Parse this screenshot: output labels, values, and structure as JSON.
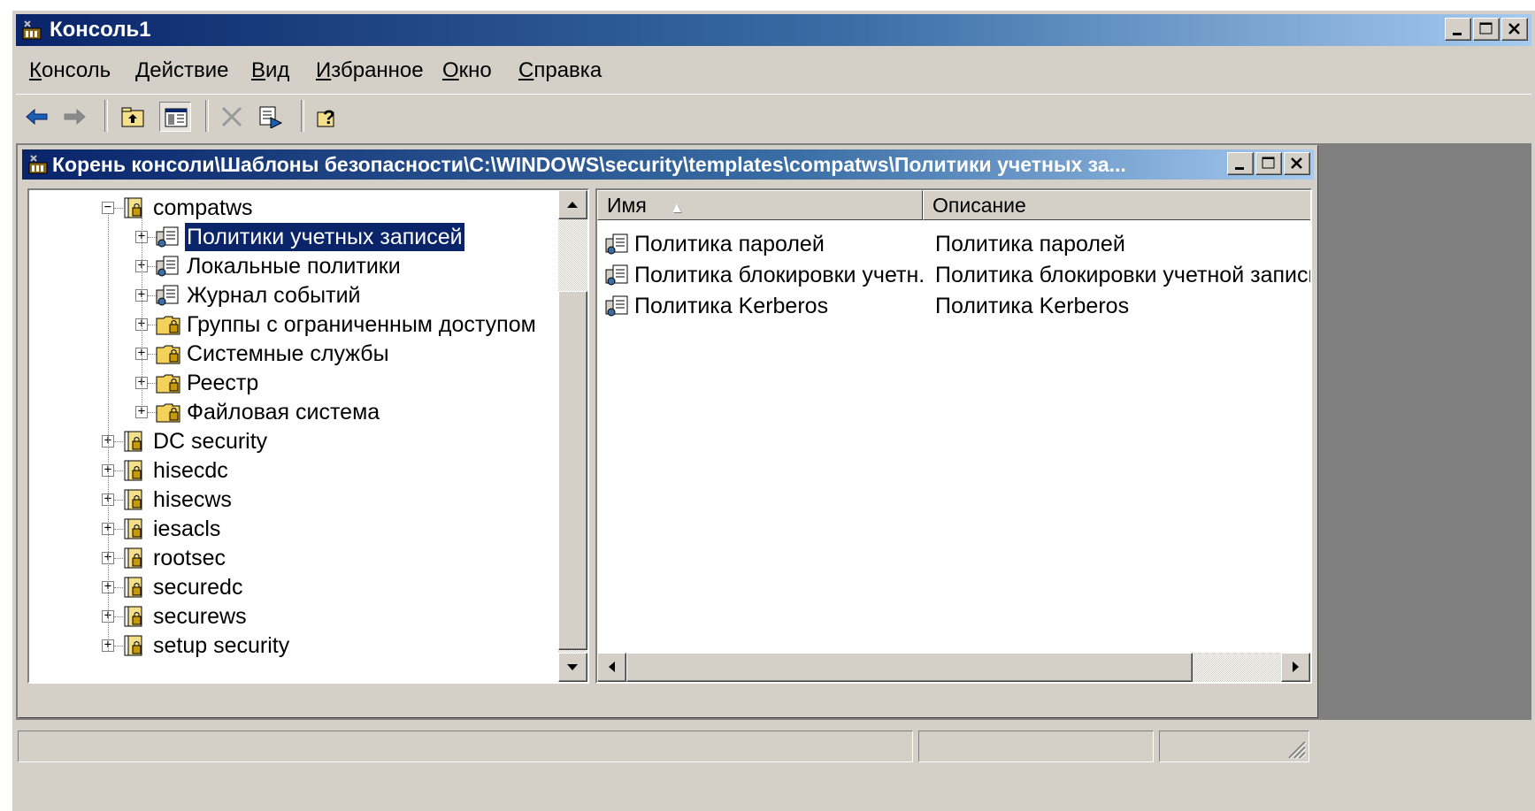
{
  "window": {
    "title": "Консоль1",
    "controls": [
      "_",
      "□",
      "×"
    ]
  },
  "menubar": {
    "items": [
      {
        "label": "Консоль",
        "accel": "К"
      },
      {
        "label": "Действие",
        "accel": "Д"
      },
      {
        "label": "Вид",
        "accel": "В"
      },
      {
        "label": "Избранное",
        "accel": "И"
      },
      {
        "label": "Окно",
        "accel": "О"
      },
      {
        "label": "Справка",
        "accel": "С"
      }
    ]
  },
  "toolbar": {
    "buttons": [
      "back-arrow-icon",
      "forward-arrow-icon",
      "up-folder-icon",
      "show-hide-tree-icon",
      "delete-icon",
      "export-list-icon",
      "help-icon"
    ]
  },
  "child_window": {
    "title": "Корень консоли\\Шаблоны безопасности\\C:\\WINDOWS\\security\\templates\\compatws\\Политики учетных за..."
  },
  "tree": {
    "nodes": [
      {
        "label": "compatws",
        "expander": "−",
        "icon": "template-icon"
      },
      {
        "label": "Политики учетных записей",
        "expander": "+",
        "icon": "policy-icon",
        "selected": true
      },
      {
        "label": "Локальные политики",
        "expander": "+",
        "icon": "policy-icon"
      },
      {
        "label": "Журнал событий",
        "expander": "+",
        "icon": "policy-icon"
      },
      {
        "label": "Группы с ограниченным доступом",
        "expander": "+",
        "icon": "folder-icon"
      },
      {
        "label": "Системные службы",
        "expander": "+",
        "icon": "folder-icon"
      },
      {
        "label": "Реестр",
        "expander": "+",
        "icon": "folder-icon"
      },
      {
        "label": "Файловая система",
        "expander": "+",
        "icon": "folder-icon"
      },
      {
        "label": "DC security",
        "expander": "+",
        "icon": "template-icon"
      },
      {
        "label": "hisecdc",
        "expander": "+",
        "icon": "template-icon"
      },
      {
        "label": "hisecws",
        "expander": "+",
        "icon": "template-icon"
      },
      {
        "label": "iesacls",
        "expander": "+",
        "icon": "template-icon"
      },
      {
        "label": "rootsec",
        "expander": "+",
        "icon": "template-icon"
      },
      {
        "label": "securedc",
        "expander": "+",
        "icon": "template-icon"
      },
      {
        "label": "securews",
        "expander": "+",
        "icon": "template-icon"
      },
      {
        "label": "setup security",
        "expander": "+",
        "icon": "template-icon"
      }
    ]
  },
  "list": {
    "columns": [
      {
        "label": "Имя",
        "sort": "▲"
      },
      {
        "label": "Описание"
      }
    ],
    "rows": [
      {
        "name": "Политика паролей",
        "description": "Политика паролей"
      },
      {
        "name": "Политика блокировки учетн...",
        "description": "Политика блокировки учетной записи"
      },
      {
        "name": "Политика Kerberos",
        "description": "Политика Kerberos"
      }
    ]
  },
  "colors": {
    "titlebar_start": "#0a246a",
    "titlebar_end": "#a6caf0",
    "face": "#d4d0c8",
    "selection": "#0a246a"
  }
}
